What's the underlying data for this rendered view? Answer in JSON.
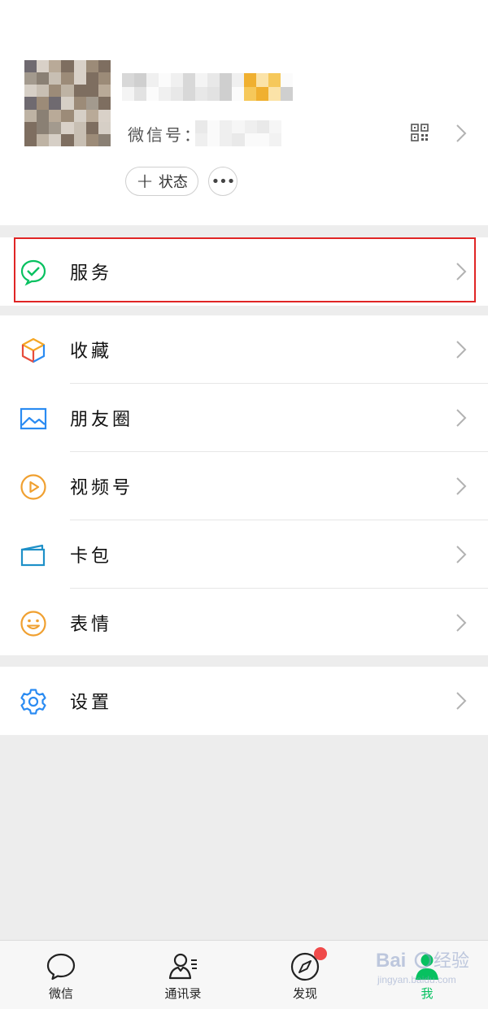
{
  "profile": {
    "wechat_id_label": "微信号：",
    "status_button_label": "状态",
    "more_button_label": "•••"
  },
  "menu": {
    "services": "服务",
    "favorites": "收藏",
    "moments": "朋友圈",
    "channels": "视频号",
    "cards": "卡包",
    "stickers": "表情",
    "settings": "设置"
  },
  "tabbar": {
    "chats": "微信",
    "contacts": "通讯录",
    "discover": "发现",
    "me": "我",
    "active_tab": "me",
    "discover_badge": true
  },
  "colors": {
    "accent_green": "#07c160",
    "highlight_red": "#e02525",
    "badge_red": "#f04a4a",
    "background": "#ededed"
  },
  "icons": [
    "services-icon",
    "favorites-icon",
    "moments-icon",
    "channels-icon",
    "cards-icon",
    "stickers-icon",
    "settings-icon",
    "qr-code-icon",
    "chevron-right-icon"
  ]
}
